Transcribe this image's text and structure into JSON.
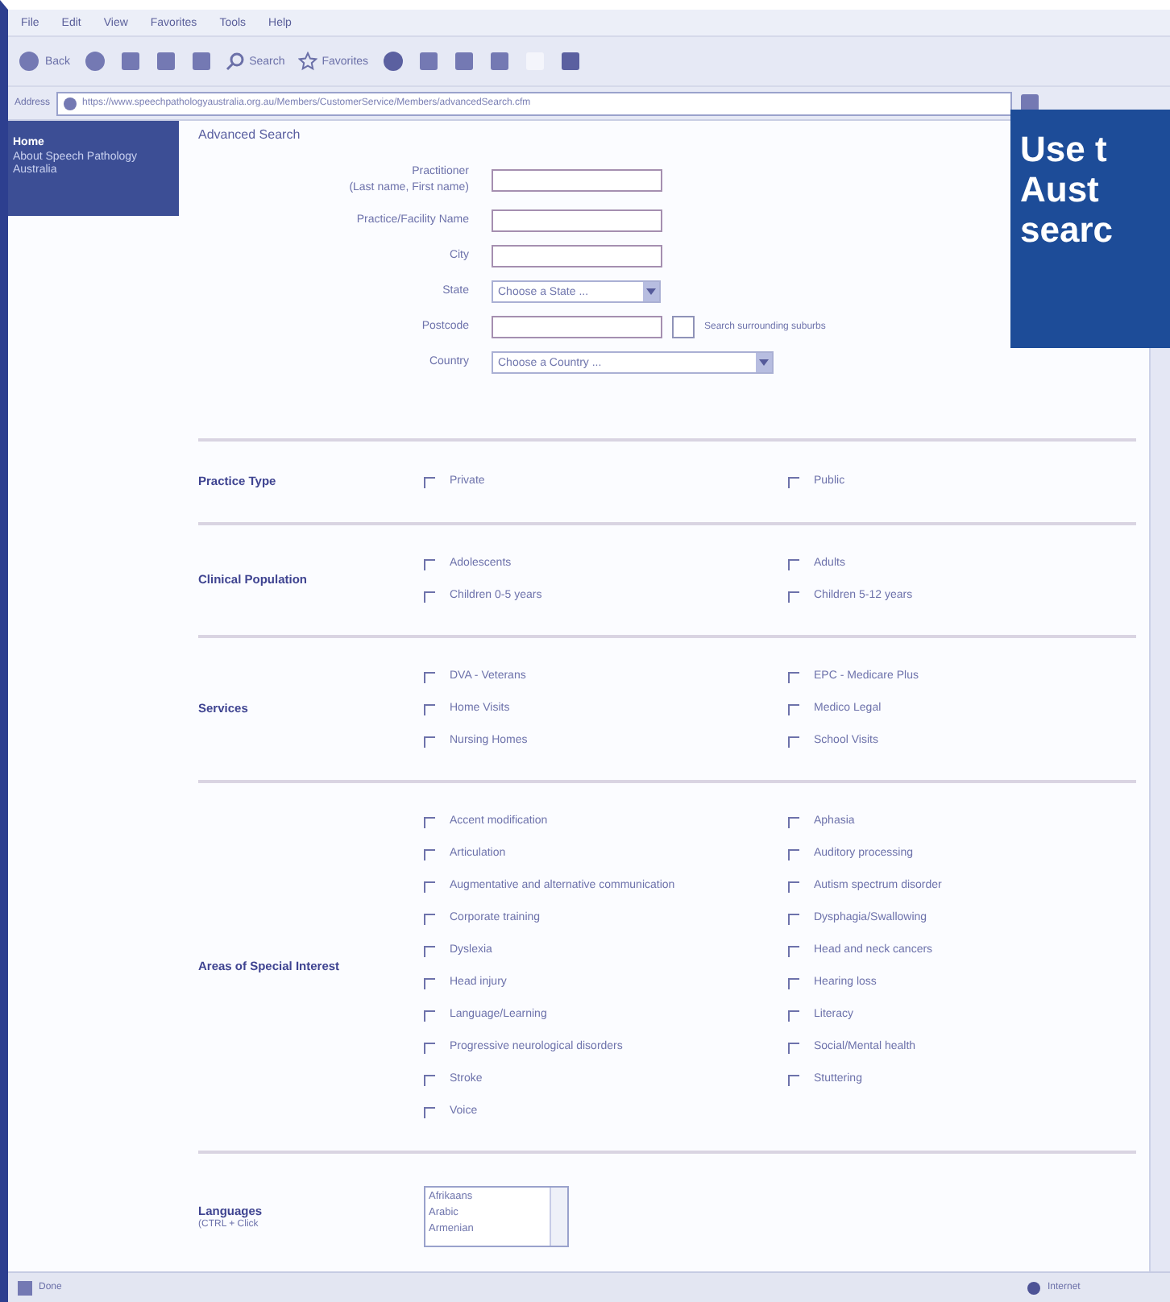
{
  "menu_bar": [
    "File",
    "Edit",
    "View",
    "Favorites",
    "Tools",
    "Help"
  ],
  "toolbar": {
    "back": "Back",
    "search": "Search",
    "favorites": "Favorites"
  },
  "address_bar": {
    "label": "Address",
    "url": "https://www.speechpathologyaustralia.org.au/Members/CustomerService/Members/advancedSearch.cfm"
  },
  "sidebar": {
    "items": [
      {
        "label": "Home",
        "selected": true
      },
      {
        "label": "About Speech Pathology Australia",
        "selected": false
      }
    ]
  },
  "page_title": "Advanced Search",
  "fields": [
    {
      "kind": "text",
      "label": "Practitioner",
      "sublabel": "(Last name, First name)"
    },
    {
      "kind": "text",
      "label": "Practice/Facility Name"
    },
    {
      "kind": "text",
      "label": "City"
    },
    {
      "kind": "select",
      "label": "State",
      "value": "Choose a State ..."
    },
    {
      "kind": "text",
      "label": "Postcode",
      "option": {
        "label": "Search surrounding suburbs",
        "checked": false
      }
    },
    {
      "kind": "select",
      "label": "Country",
      "value": "Choose a Country ..."
    }
  ],
  "sections": [
    {
      "title": "Practice Type",
      "options": [
        {
          "label": "Private",
          "checked": false
        },
        {
          "label": "Public",
          "checked": false
        }
      ]
    },
    {
      "title": "Clinical Population",
      "options": [
        {
          "label": "Adolescents",
          "checked": false
        },
        {
          "label": "Adults",
          "checked": false
        },
        {
          "label": "Children 0-5 years",
          "checked": false
        },
        {
          "label": "Children 5-12 years",
          "checked": false
        }
      ]
    },
    {
      "title": "Services",
      "options": [
        {
          "label": "DVA - Veterans",
          "checked": false
        },
        {
          "label": "EPC - Medicare Plus",
          "checked": false
        },
        {
          "label": "Home Visits",
          "checked": false
        },
        {
          "label": "Medico Legal",
          "checked": false
        },
        {
          "label": "Nursing Homes",
          "checked": false
        },
        {
          "label": "School Visits",
          "checked": false
        }
      ]
    },
    {
      "title": "Areas of Special Interest",
      "columns": [
        [
          {
            "label": "Accent modification",
            "checked": false
          },
          {
            "label": "Articulation",
            "checked": false
          },
          {
            "label": "Augmentative and alternative communication",
            "checked": false
          },
          {
            "label": "Corporate training",
            "checked": false
          },
          {
            "label": "Dyslexia",
            "checked": false
          },
          {
            "label": "Head injury",
            "checked": false
          },
          {
            "label": "Language/Learning",
            "checked": false
          },
          {
            "label": "Progressive neurological disorders",
            "checked": false
          },
          {
            "label": "Stroke",
            "checked": false
          },
          {
            "label": "Voice",
            "checked": false
          }
        ],
        [
          {
            "label": "Aphasia",
            "checked": false
          },
          {
            "label": "Auditory processing",
            "checked": false
          },
          {
            "label": "Autism spectrum disorder",
            "checked": false
          },
          {
            "label": "Dysphagia/Swallowing",
            "checked": false
          },
          {
            "label": "Head and neck cancers",
            "checked": false
          },
          {
            "label": "Hearing loss",
            "checked": false
          },
          {
            "label": "Literacy",
            "checked": false
          },
          {
            "label": "Social/Mental health",
            "checked": false
          },
          {
            "label": "Stuttering",
            "checked": false
          }
        ]
      ]
    }
  ],
  "languages": {
    "title": "Languages",
    "hint": "(CTRL + Click",
    "options": [
      "Afrikaans",
      "Arabic",
      "Armenian"
    ]
  },
  "status_bar": {
    "text": "Done",
    "zone": "Internet"
  },
  "callout": {
    "lines": [
      "Use t",
      "Aust",
      "searc"
    ]
  }
}
